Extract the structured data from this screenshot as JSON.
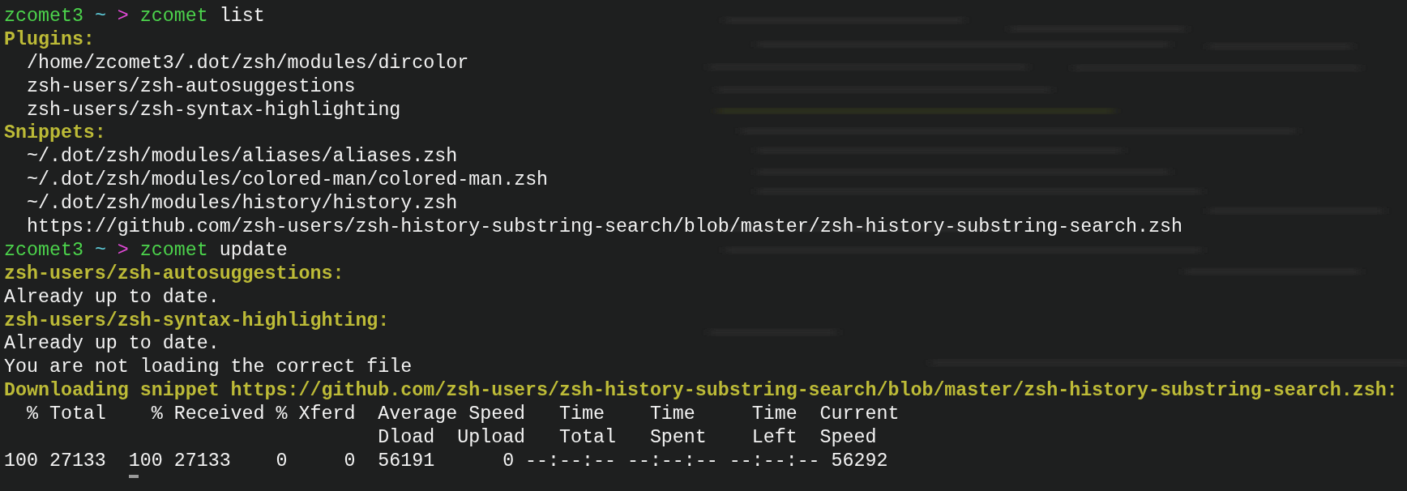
{
  "lines": [
    {
      "kind": "prompt",
      "user": "zcomet3",
      "dir": "~",
      "symbol": ">",
      "command": "zcomet",
      "args": "list"
    },
    {
      "kind": "section",
      "title": "Plugins:",
      "items": [
        "/home/zcomet3/.dot/zsh/modules/dircolor",
        "zsh-users/zsh-autosuggestions",
        "zsh-users/zsh-syntax-highlighting"
      ]
    },
    {
      "kind": "section",
      "title": "Snippets:",
      "items": [
        "~/.dot/zsh/modules/aliases/aliases.zsh",
        "~/.dot/zsh/modules/colored-man/colored-man.zsh",
        "~/.dot/zsh/modules/history/history.zsh",
        "https://github.com/zsh-users/zsh-history-substring-search/blob/master/zsh-history-substring-search.zsh"
      ]
    },
    {
      "kind": "prompt",
      "user": "zcomet3",
      "dir": "~",
      "symbol": ">",
      "command": "zcomet",
      "args": "update"
    },
    {
      "kind": "heading",
      "text": "zsh-users/zsh-autosuggestions:"
    },
    {
      "kind": "output",
      "text": "Already up to date."
    },
    {
      "kind": "heading",
      "text": "zsh-users/zsh-syntax-highlighting:"
    },
    {
      "kind": "output",
      "text": "Already up to date."
    },
    {
      "kind": "output",
      "text": "You are not loading the correct file"
    },
    {
      "kind": "heading",
      "text": "Downloading snippet https://github.com/zsh-users/zsh-history-substring-search/blob/master/zsh-history-substring-search.zsh:"
    },
    {
      "kind": "output",
      "text": "  % Total    % Received % Xferd  Average Speed   Time    Time     Time  Current"
    },
    {
      "kind": "output",
      "text": "                                 Dload  Upload   Total   Spent    Left  Speed"
    },
    {
      "kind": "output",
      "text": "100 27133  100 27133    0     0  56191      0 --:--:-- --:--:-- --:--:-- 56292"
    },
    {
      "kind": "cursor"
    }
  ]
}
